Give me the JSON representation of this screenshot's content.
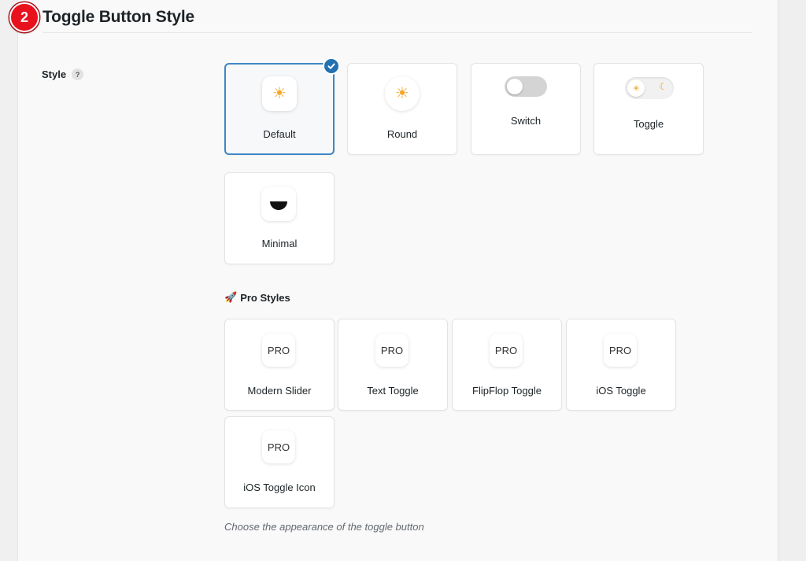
{
  "section": {
    "step_number": "2",
    "title": "Toggle Button Style"
  },
  "field": {
    "label": "Style",
    "help_glyph": "?"
  },
  "styles": [
    {
      "label": "Default",
      "icon": "sun-icon",
      "glyph": "☀",
      "selected": true
    },
    {
      "label": "Round",
      "icon": "sun-icon",
      "glyph": "☀",
      "selected": false
    },
    {
      "label": "Switch",
      "icon": "switch-icon",
      "selected": false
    },
    {
      "label": "Toggle",
      "icon": "sun-moon-toggle-icon",
      "glyph_sun": "☀",
      "glyph_moon": "☾",
      "selected": false
    },
    {
      "label": "Minimal",
      "icon": "half-circle-icon",
      "selected": false
    }
  ],
  "pro": {
    "heading": "Pro Styles",
    "heading_icon": "🚀",
    "badge_text": "PRO",
    "items": [
      {
        "label": "Modern Slider"
      },
      {
        "label": "Text Toggle"
      },
      {
        "label": "FlipFlop Toggle"
      },
      {
        "label": "iOS Toggle"
      },
      {
        "label": "iOS Toggle Icon"
      }
    ]
  },
  "helper_text": "Choose the appearance of the toggle button",
  "colors": {
    "accent": "#2271b1",
    "step_badge": "#e8121d",
    "sun": "#f5a623"
  }
}
